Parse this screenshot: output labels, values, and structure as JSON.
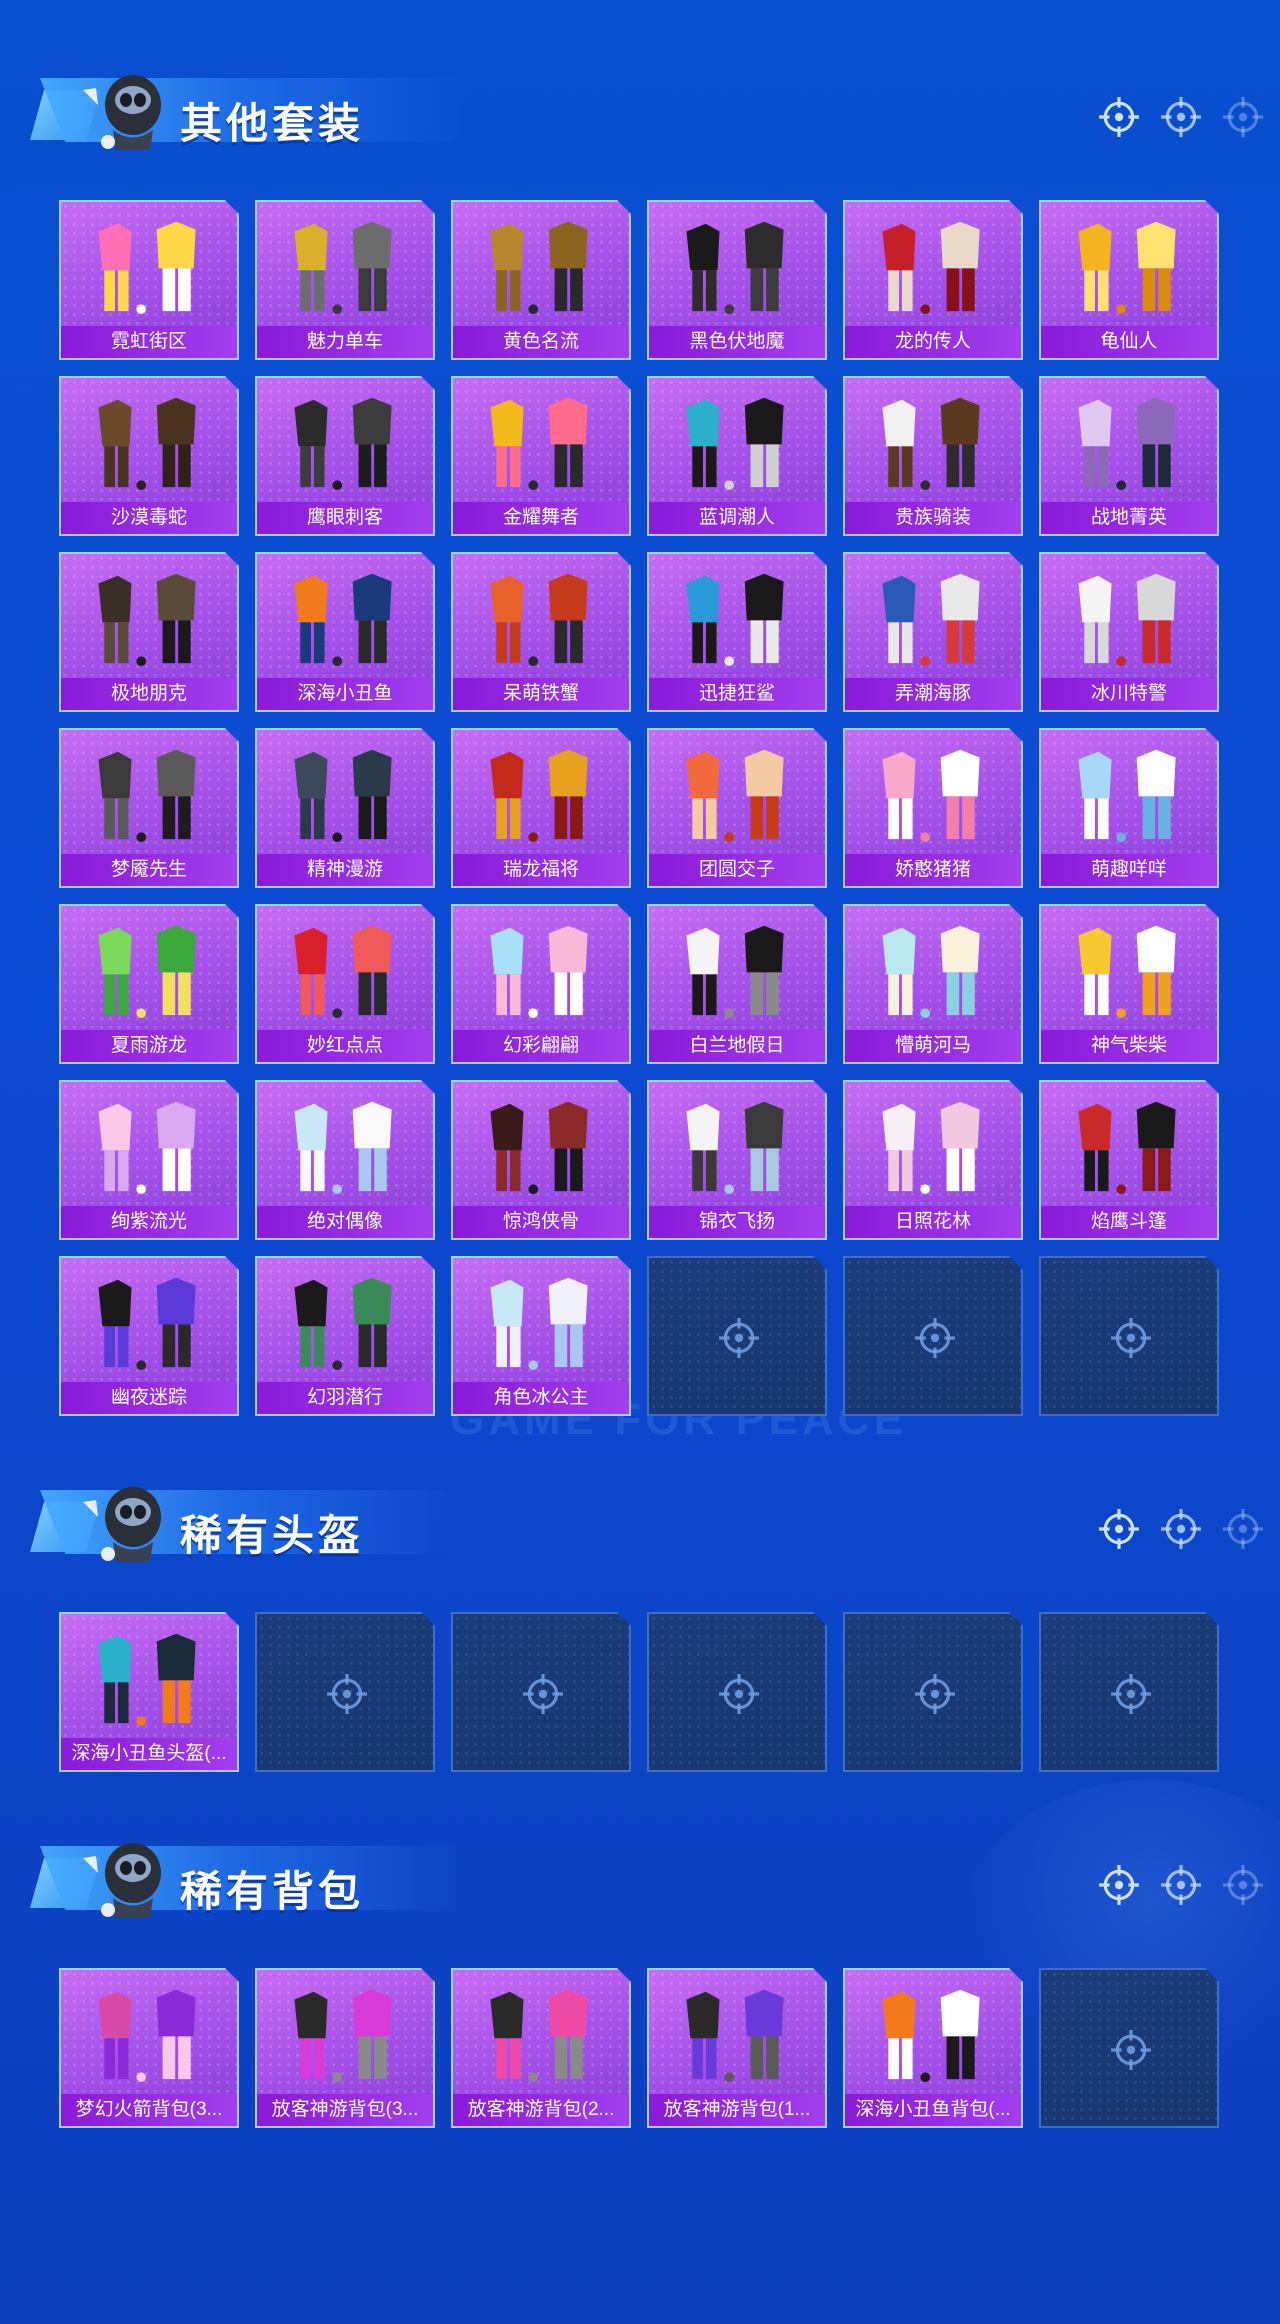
{
  "sections": [
    {
      "title": "其他套装",
      "items": [
        {
          "label": "霓虹街区",
          "colors": [
            "#ff6fb5",
            "#ffd84a",
            "#ffffff"
          ]
        },
        {
          "label": "魅力单车",
          "colors": [
            "#d9b02a",
            "#6d6d6d",
            "#3a3a3a"
          ]
        },
        {
          "label": "黄色名流",
          "colors": [
            "#b8862e",
            "#8b6420",
            "#2a2a2a"
          ]
        },
        {
          "label": "黑色伏地魔",
          "colors": [
            "#1a1a1a",
            "#2d2d2d",
            "#3c3c3c"
          ]
        },
        {
          "label": "龙的传人",
          "colors": [
            "#c8202a",
            "#e8d8c8",
            "#8a1018"
          ]
        },
        {
          "label": "龟仙人",
          "colors": [
            "#f2b51e",
            "#ffe070",
            "#d98a10"
          ]
        },
        {
          "label": "沙漠毒蛇",
          "colors": [
            "#6b4a2a",
            "#4a3420",
            "#2e2316"
          ]
        },
        {
          "label": "鹰眼刺客",
          "colors": [
            "#2b2b2b",
            "#3c3c3c",
            "#1d1d1d"
          ]
        },
        {
          "label": "金耀舞者",
          "colors": [
            "#f3b81c",
            "#ff6b8a",
            "#2a2a2a"
          ]
        },
        {
          "label": "蓝调潮人",
          "colors": [
            "#2ab0c8",
            "#1a1a1a",
            "#cfcfcf"
          ]
        },
        {
          "label": "贵族骑装",
          "colors": [
            "#f0f0f0",
            "#5a3a20",
            "#2d2d2d"
          ]
        },
        {
          "label": "战地菁英",
          "colors": [
            "#e0c8f0",
            "#8a6ab8",
            "#1d2a3a"
          ]
        },
        {
          "label": "极地朋克",
          "colors": [
            "#3a3028",
            "#5a4a38",
            "#1a1a1a"
          ]
        },
        {
          "label": "深海小丑鱼",
          "colors": [
            "#f27a1a",
            "#1a3a7a",
            "#2a2a2a"
          ]
        },
        {
          "label": "呆萌铁蟹",
          "colors": [
            "#e8602a",
            "#c43a1a",
            "#2a2a2a"
          ]
        },
        {
          "label": "迅捷狂鲨",
          "colors": [
            "#2a9ad8",
            "#1a1a1a",
            "#e8e8e8"
          ]
        },
        {
          "label": "弄潮海豚",
          "colors": [
            "#2a5ab8",
            "#e8e8e8",
            "#d83a3a"
          ]
        },
        {
          "label": "冰川特警",
          "colors": [
            "#f4f4f4",
            "#d8d8d8",
            "#c82a2a"
          ]
        },
        {
          "label": "梦魇先生",
          "colors": [
            "#3a3a3a",
            "#5a5a5a",
            "#1d1d1d"
          ]
        },
        {
          "label": "精神漫游",
          "colors": [
            "#3a4a5a",
            "#2a3a4a",
            "#1a1a1a"
          ]
        },
        {
          "label": "瑞龙福将",
          "colors": [
            "#c42a1a",
            "#e8a020",
            "#8a1a10"
          ]
        },
        {
          "label": "团圆交子",
          "colors": [
            "#f26a3a",
            "#f4c8a0",
            "#c83a1a"
          ]
        },
        {
          "label": "娇憨猪猪",
          "colors": [
            "#f8a8c8",
            "#ffffff",
            "#f080a8"
          ]
        },
        {
          "label": "萌趣咩咩",
          "colors": [
            "#a8d8f8",
            "#ffffff",
            "#6ab0e0"
          ]
        },
        {
          "label": "夏雨游龙",
          "colors": [
            "#7ad85a",
            "#3aa83a",
            "#f0e060"
          ]
        },
        {
          "label": "妙红点点",
          "colors": [
            "#d8202a",
            "#f05a5a",
            "#2a2a2a"
          ]
        },
        {
          "label": "幻彩翩翩",
          "colors": [
            "#a8e0f8",
            "#f8b8d8",
            "#ffffff"
          ]
        },
        {
          "label": "白兰地假日",
          "colors": [
            "#f4f4f4",
            "#1a1a1a",
            "#8a8a8a"
          ]
        },
        {
          "label": "懵萌河马",
          "colors": [
            "#b8e8f0",
            "#f8f0d8",
            "#8ad0e0"
          ]
        },
        {
          "label": "神气柴柴",
          "colors": [
            "#f8c830",
            "#ffffff",
            "#f0a020"
          ]
        },
        {
          "label": "绚紫流光",
          "colors": [
            "#f8c8e8",
            "#d8a8f0",
            "#ffffff"
          ]
        },
        {
          "label": "绝对偶像",
          "colors": [
            "#c8e8f8",
            "#f8f8f8",
            "#a8c8f0"
          ]
        },
        {
          "label": "惊鸿侠骨",
          "colors": [
            "#3a1a1a",
            "#8a2a2a",
            "#1a1a1a"
          ]
        },
        {
          "label": "锦衣飞扬",
          "colors": [
            "#f4f4f4",
            "#3a3a3a",
            "#a8c8e0"
          ]
        },
        {
          "label": "日照花林",
          "colors": [
            "#f8f0f8",
            "#f0c8e0",
            "#ffffff"
          ]
        },
        {
          "label": "焰鹰斗篷",
          "colors": [
            "#c82a2a",
            "#1a1a1a",
            "#8a1a1a"
          ]
        },
        {
          "label": "幽夜迷踪",
          "colors": [
            "#1a1a1a",
            "#5a3ad8",
            "#2a2a2a"
          ]
        },
        {
          "label": "幻羽潜行",
          "colors": [
            "#1a1a1a",
            "#3a8a5a",
            "#2a2a2a"
          ]
        },
        {
          "label": "角色冰公主",
          "colors": [
            "#c8e8f8",
            "#f0f0f8",
            "#a8c8f0"
          ]
        },
        {
          "label": null
        },
        {
          "label": null
        },
        {
          "label": null
        }
      ]
    },
    {
      "title": "稀有头盔",
      "items": [
        {
          "label": "深海小丑鱼头盔(...",
          "colors": [
            "#2ab0c8",
            "#1a2a3a",
            "#f27a1a"
          ]
        },
        {
          "label": null
        },
        {
          "label": null
        },
        {
          "label": null
        },
        {
          "label": null
        },
        {
          "label": null
        }
      ]
    },
    {
      "title": "稀有背包",
      "items": [
        {
          "label": "梦幻火箭背包(3...",
          "colors": [
            "#d84aa8",
            "#8a2ad8",
            "#f8c8e8"
          ]
        },
        {
          "label": "放客神游背包(3...",
          "colors": [
            "#2a2a2a",
            "#d83ad8",
            "#8a8a8a"
          ]
        },
        {
          "label": "放客神游背包(2...",
          "colors": [
            "#2a2a2a",
            "#f04aa8",
            "#8a8a8a"
          ]
        },
        {
          "label": "放客神游背包(1...",
          "colors": [
            "#2a2a2a",
            "#6a3ad8",
            "#5a5a5a"
          ]
        },
        {
          "label": "深海小丑鱼背包(...",
          "colors": [
            "#f27a1a",
            "#ffffff",
            "#1a1a1a"
          ]
        },
        {
          "label": null
        }
      ]
    }
  ],
  "watermark": "GAME FOR PEACE"
}
